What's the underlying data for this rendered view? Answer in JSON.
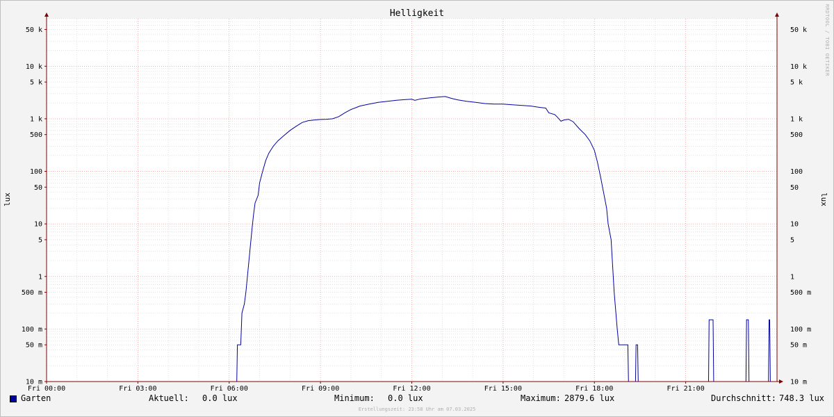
{
  "chart_data": {
    "type": "line",
    "title": "Helligkeit",
    "ylabel": "lux",
    "y_scale": "log",
    "ylim": [
      0.01,
      80000
    ],
    "y_ticks": [
      {
        "v": 50000,
        "label": "50 k"
      },
      {
        "v": 10000,
        "label": "10 k"
      },
      {
        "v": 5000,
        "label": "5 k"
      },
      {
        "v": 1000,
        "label": "1 k"
      },
      {
        "v": 500,
        "label": "500"
      },
      {
        "v": 100,
        "label": "100"
      },
      {
        "v": 50,
        "label": "50"
      },
      {
        "v": 10,
        "label": "10"
      },
      {
        "v": 5,
        "label": "5"
      },
      {
        "v": 1,
        "label": "1"
      },
      {
        "v": 0.5,
        "label": "500 m"
      },
      {
        "v": 0.1,
        "label": "100 m"
      },
      {
        "v": 0.05,
        "label": "50 m"
      },
      {
        "v": 0.01,
        "label": "10 m"
      }
    ],
    "x_ticks": [
      {
        "h": 0,
        "label": "Fri 00:00"
      },
      {
        "h": 3,
        "label": "Fri 03:00"
      },
      {
        "h": 6,
        "label": "Fri 06:00"
      },
      {
        "h": 9,
        "label": "Fri 09:00"
      },
      {
        "h": 12,
        "label": "Fri 12:00"
      },
      {
        "h": 15,
        "label": "Fri 15:00"
      },
      {
        "h": 18,
        "label": "Fri 18:00"
      },
      {
        "h": 21,
        "label": "Fri 21:00"
      }
    ],
    "xlim_hours": [
      0,
      24
    ],
    "grid": true,
    "series": [
      {
        "name": "Garten",
        "color": "#0000a0",
        "points": [
          [
            0,
            0.01
          ],
          [
            6.25,
            0.01
          ],
          [
            6.27,
            0.05
          ],
          [
            6.38,
            0.05
          ],
          [
            6.42,
            0.2
          ],
          [
            6.5,
            0.3
          ],
          [
            6.55,
            0.5
          ],
          [
            6.6,
            1
          ],
          [
            6.65,
            2
          ],
          [
            6.7,
            4
          ],
          [
            6.75,
            8
          ],
          [
            6.8,
            15
          ],
          [
            6.85,
            25
          ],
          [
            6.95,
            35
          ],
          [
            7.0,
            60
          ],
          [
            7.1,
            100
          ],
          [
            7.2,
            160
          ],
          [
            7.3,
            220
          ],
          [
            7.45,
            300
          ],
          [
            7.6,
            380
          ],
          [
            7.8,
            480
          ],
          [
            8.0,
            600
          ],
          [
            8.2,
            720
          ],
          [
            8.4,
            850
          ],
          [
            8.6,
            920
          ],
          [
            8.8,
            950
          ],
          [
            9.0,
            970
          ],
          [
            9.2,
            980
          ],
          [
            9.4,
            1000
          ],
          [
            9.6,
            1100
          ],
          [
            9.8,
            1300
          ],
          [
            10.0,
            1500
          ],
          [
            10.3,
            1750
          ],
          [
            10.6,
            1900
          ],
          [
            10.9,
            2050
          ],
          [
            11.2,
            2150
          ],
          [
            11.5,
            2250
          ],
          [
            11.8,
            2320
          ],
          [
            12.0,
            2350
          ],
          [
            12.1,
            2250
          ],
          [
            12.3,
            2400
          ],
          [
            12.6,
            2500
          ],
          [
            12.9,
            2600
          ],
          [
            13.1,
            2650
          ],
          [
            13.3,
            2450
          ],
          [
            13.5,
            2300
          ],
          [
            13.8,
            2150
          ],
          [
            14.1,
            2050
          ],
          [
            14.4,
            1950
          ],
          [
            14.7,
            1900
          ],
          [
            15.0,
            1900
          ],
          [
            15.3,
            1850
          ],
          [
            15.6,
            1800
          ],
          [
            15.9,
            1750
          ],
          [
            16.2,
            1650
          ],
          [
            16.4,
            1600
          ],
          [
            16.5,
            1300
          ],
          [
            16.7,
            1200
          ],
          [
            16.8,
            1050
          ],
          [
            16.9,
            900
          ],
          [
            17.0,
            950
          ],
          [
            17.15,
            980
          ],
          [
            17.3,
            880
          ],
          [
            17.5,
            650
          ],
          [
            17.7,
            500
          ],
          [
            17.85,
            380
          ],
          [
            18.0,
            250
          ],
          [
            18.1,
            150
          ],
          [
            18.2,
            80
          ],
          [
            18.3,
            40
          ],
          [
            18.4,
            20
          ],
          [
            18.45,
            10
          ],
          [
            18.55,
            5
          ],
          [
            18.65,
            0.5
          ],
          [
            18.75,
            0.1
          ],
          [
            18.8,
            0.05
          ],
          [
            19.1,
            0.05
          ],
          [
            19.12,
            0.01
          ],
          [
            19.35,
            0.01
          ],
          [
            19.37,
            0.05
          ],
          [
            19.42,
            0.05
          ],
          [
            19.44,
            0.01
          ],
          [
            21.75,
            0.01
          ],
          [
            21.77,
            0.15
          ],
          [
            21.9,
            0.15
          ],
          [
            21.92,
            0.01
          ],
          [
            22.98,
            0.01
          ],
          [
            23.0,
            0.15
          ],
          [
            23.06,
            0.15
          ],
          [
            23.08,
            0.01
          ],
          [
            23.72,
            0.01
          ],
          [
            23.74,
            0.15
          ],
          [
            23.76,
            0.15
          ],
          [
            23.78,
            0.01
          ],
          [
            24,
            0.01
          ]
        ]
      }
    ]
  },
  "legend": {
    "series_name": "Garten",
    "current_label": "Aktuell:",
    "current_value": "0.0 lux",
    "minimum_label": "Minimum:",
    "minimum_value": "0.0 lux",
    "maximum_label": "Maximum:",
    "maximum_value": "2879.6 lux",
    "average_label": "Durchschnitt:",
    "average_value": "748.3 lux"
  },
  "footer": "Erstellungszeit: 23:58 Uhr am 07.03.2025",
  "vendor_text": "RRDTOOL / TOBI OETIKER",
  "colors": {
    "line": "#0000a0",
    "major_grid": "#f08080",
    "minor_grid": "#d0d0d0",
    "axis": "#800000",
    "plot_bg": "#ffffff"
  }
}
